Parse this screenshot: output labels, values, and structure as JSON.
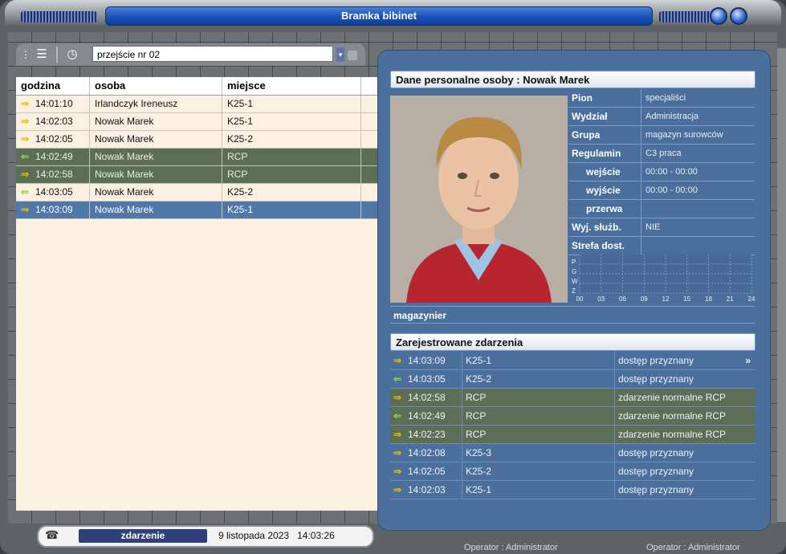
{
  "window": {
    "title": "Bramka bibinet"
  },
  "toolbar": {
    "passage_value": "przejście nr 02"
  },
  "events": {
    "columns": [
      "godzina",
      "osoba",
      "miejsce"
    ],
    "rows": [
      {
        "time": "14:01:10",
        "person": "Irlandczyk Ireneusz",
        "place": "K25-1",
        "dir": "in",
        "style": "normal"
      },
      {
        "time": "14:02:03",
        "person": "Nowak Marek",
        "place": "K25-1",
        "dir": "in",
        "style": "normal"
      },
      {
        "time": "14:02:05",
        "person": "Nowak Marek",
        "place": "K25-2",
        "dir": "in",
        "style": "normal"
      },
      {
        "time": "14:02:49",
        "person": "Nowak Marek",
        "place": "RCP",
        "dir": "out",
        "style": "green"
      },
      {
        "time": "14:02:58",
        "person": "Nowak Marek",
        "place": "RCP",
        "dir": "in",
        "style": "green"
      },
      {
        "time": "14:03:05",
        "person": "Nowak Marek",
        "place": "K25-2",
        "dir": "out",
        "style": "normal"
      },
      {
        "time": "14:03:09",
        "person": "Nowak Marek",
        "place": "K25-1",
        "dir": "in",
        "style": "selected"
      }
    ]
  },
  "person": {
    "header": "Dane personalne osoby : Nowak Marek",
    "fields": [
      {
        "label": "Pion",
        "value": "specjaliści",
        "indent": false
      },
      {
        "label": "Wydział",
        "value": "Administracja",
        "indent": false
      },
      {
        "label": "Grupa",
        "value": "magazyn surowców",
        "indent": false
      },
      {
        "label": "Regulamin",
        "value": "C3 praca",
        "indent": false
      },
      {
        "label": "wejście",
        "value": "00:00 - 00:00",
        "indent": true
      },
      {
        "label": "wyjście",
        "value": "00:00 - 00:00",
        "indent": true
      },
      {
        "label": "przerwa",
        "value": "",
        "indent": true
      },
      {
        "label": "Wyj. służb.",
        "value": "NIE",
        "indent": false
      },
      {
        "label": "Strefa dost.",
        "value": "",
        "indent": false
      }
    ],
    "chart_letters": [
      "P",
      "G",
      "W",
      "Z"
    ],
    "chart_hours": [
      "00",
      "03",
      "06",
      "09",
      "12",
      "15",
      "18",
      "21",
      "24"
    ],
    "job": "magazynier"
  },
  "registered": {
    "header": "Zarejestrowane zdarzenia",
    "more_label": "»",
    "rows": [
      {
        "time": "14:03:09",
        "place": "K25-1",
        "status": "dostęp przyznany",
        "dir": "in",
        "style": "normal"
      },
      {
        "time": "14:03:05",
        "place": "K25-2",
        "status": "dostęp przyznany",
        "dir": "out",
        "style": "normal"
      },
      {
        "time": "14:02:58",
        "place": "RCP",
        "status": "zdarzenie normalne RCP",
        "dir": "in",
        "style": "green"
      },
      {
        "time": "14:02:49",
        "place": "RCP",
        "status": "zdarzenie normalne RCP",
        "dir": "out",
        "style": "green"
      },
      {
        "time": "14:02:23",
        "place": "RCP",
        "status": "zdarzenie normalne RCP",
        "dir": "in",
        "style": "green"
      },
      {
        "time": "14:02:08",
        "place": "K25-3",
        "status": "dostęp przyznany",
        "dir": "in",
        "style": "normal"
      },
      {
        "time": "14:02:05",
        "place": "K25-2",
        "status": "dostęp przyznany",
        "dir": "in",
        "style": "normal"
      },
      {
        "time": "14:02:03",
        "place": "K25-1",
        "status": "dostęp przyznany",
        "dir": "in",
        "style": "normal"
      }
    ]
  },
  "status": {
    "event_type": "zdarzenie",
    "date": "9 listopada 2023",
    "time": "14:03:26"
  },
  "operators": [
    "Operator : Administrator",
    "Operator : Administrator"
  ],
  "colors": {
    "accent_blue": "#4b6f9c",
    "row_green": "#5c6e55",
    "row_selected": "#4f77a8",
    "arrow_yellow": "#e0c000",
    "arrow_green": "#8fd14f"
  }
}
